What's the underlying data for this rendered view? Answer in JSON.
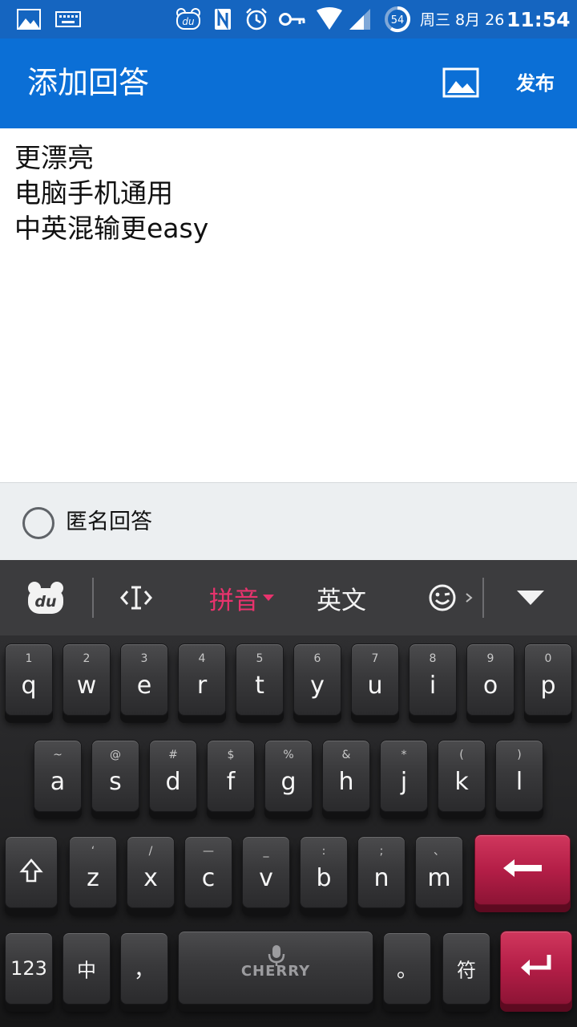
{
  "statusbar": {
    "date": "周三 8月 26",
    "time": "11:54",
    "battery_level": "54",
    "icons": [
      "image-icon",
      "keyboard-icon",
      "du-icon",
      "nfc-icon",
      "alarm-icon",
      "key-icon",
      "wifi-icon",
      "signal-icon",
      "battery-icon"
    ]
  },
  "appbar": {
    "title": "添加回答",
    "publish_label": "发布",
    "accent": "#0b6fd6"
  },
  "editor": {
    "lines": [
      "更漂亮",
      "电脑手机通用",
      "中英混输更easy"
    ]
  },
  "anonymous": {
    "label": "匿名回答",
    "checked": false
  },
  "keyboard_toolbar": {
    "pinyin_label": "拼音",
    "english_label": "英文",
    "pinyin_color": "#e8336d"
  },
  "keyboard": {
    "row1": [
      {
        "main": "q",
        "sub": "1"
      },
      {
        "main": "w",
        "sub": "2"
      },
      {
        "main": "e",
        "sub": "3"
      },
      {
        "main": "r",
        "sub": "4"
      },
      {
        "main": "t",
        "sub": "5"
      },
      {
        "main": "y",
        "sub": "6"
      },
      {
        "main": "u",
        "sub": "7"
      },
      {
        "main": "i",
        "sub": "8"
      },
      {
        "main": "o",
        "sub": "9"
      },
      {
        "main": "p",
        "sub": "0"
      }
    ],
    "row2": [
      {
        "main": "a",
        "sub": "~"
      },
      {
        "main": "s",
        "sub": "@"
      },
      {
        "main": "d",
        "sub": "#"
      },
      {
        "main": "f",
        "sub": "$"
      },
      {
        "main": "g",
        "sub": "%"
      },
      {
        "main": "h",
        "sub": "&"
      },
      {
        "main": "j",
        "sub": "*"
      },
      {
        "main": "k",
        "sub": "("
      },
      {
        "main": "l",
        "sub": ")"
      }
    ],
    "row3": [
      {
        "main": "z",
        "sub": "‘"
      },
      {
        "main": "x",
        "sub": "/"
      },
      {
        "main": "c",
        "sub": "—"
      },
      {
        "main": "v",
        "sub": "_"
      },
      {
        "main": "b",
        "sub": ":"
      },
      {
        "main": "n",
        "sub": ";"
      },
      {
        "main": "m",
        "sub": "、"
      }
    ],
    "row4": {
      "numbers_label": "123",
      "chinese_label": "中",
      "comma_label": "，",
      "space_brand": "CHERRY",
      "period_label": "。",
      "symbols_label": "符"
    },
    "accent": "#b41e47"
  }
}
